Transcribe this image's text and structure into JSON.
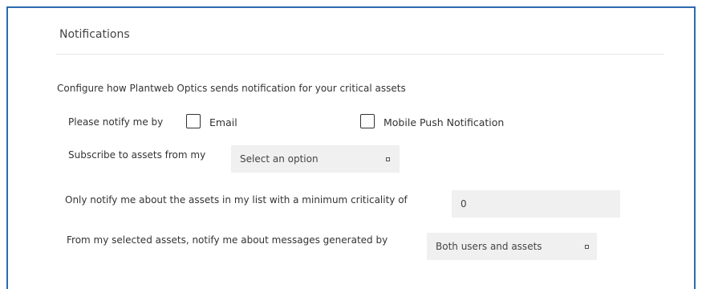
{
  "section": {
    "title": "Notifications",
    "description": "Configure how Plantweb Optics sends notification for your critical assets"
  },
  "notify_by": {
    "label": "Please notify me by",
    "options": [
      {
        "label": "Email",
        "checked": false
      },
      {
        "label": "Mobile Push Notification",
        "checked": false
      }
    ]
  },
  "subscribe": {
    "label": "Subscribe to assets from my",
    "selected": "Select an option"
  },
  "criticality": {
    "label": "Only notify me about the assets in my list with a minimum criticality of",
    "value": "0"
  },
  "generated_by": {
    "label": "From my selected assets, notify me about messages generated by",
    "selected": "Both users and assets"
  },
  "colors": {
    "frame_border": "#2b6cb0",
    "field_background": "#f0f0f0"
  }
}
